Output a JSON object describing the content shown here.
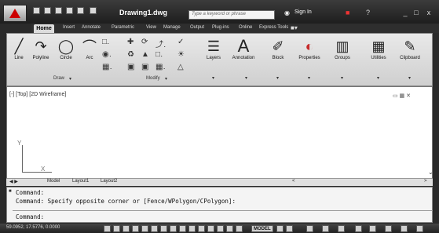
{
  "title": {
    "document": "Drawing1.dwg",
    "search_placeholder": "Type a keyword or phrase",
    "signin": "Sign In"
  },
  "ribbon_tabs": [
    "Home",
    "Insert",
    "Annotate",
    "Parametric",
    "View",
    "Manage",
    "Output",
    "Plug-ins",
    "Online",
    "Express Tools"
  ],
  "tools": {
    "line": "Line",
    "polyline": "Polyline",
    "circle": "Circle",
    "arc": "Arc",
    "layers": "Layers",
    "annotation": "Annotation",
    "block": "Block",
    "properties": "Properties",
    "groups": "Groups",
    "utilities": "Utilities",
    "clipboard": "Clipboard"
  },
  "panels": {
    "draw": "Draw",
    "modify": "Modify"
  },
  "viewport": {
    "label": "[-] [Top] [2D Wireframe]",
    "axis_y": "Y",
    "axis_x": "X"
  },
  "layout_tabs": [
    "Model",
    "Layout1",
    "Layout2"
  ],
  "command": {
    "line1": "Command:",
    "line2": "Command: Specify opposite corner or [Fence/WPolygon/CPolygon]:",
    "prompt": "Command:"
  },
  "status": {
    "coords": "59.0952, 17.5776, 0.0000",
    "model": "MODEL"
  },
  "colors": {
    "titlebar": "#2a2a2a",
    "ribbon": "#dcdcdc",
    "viewport": "#ffffff",
    "accent_red": "#cc0000"
  }
}
